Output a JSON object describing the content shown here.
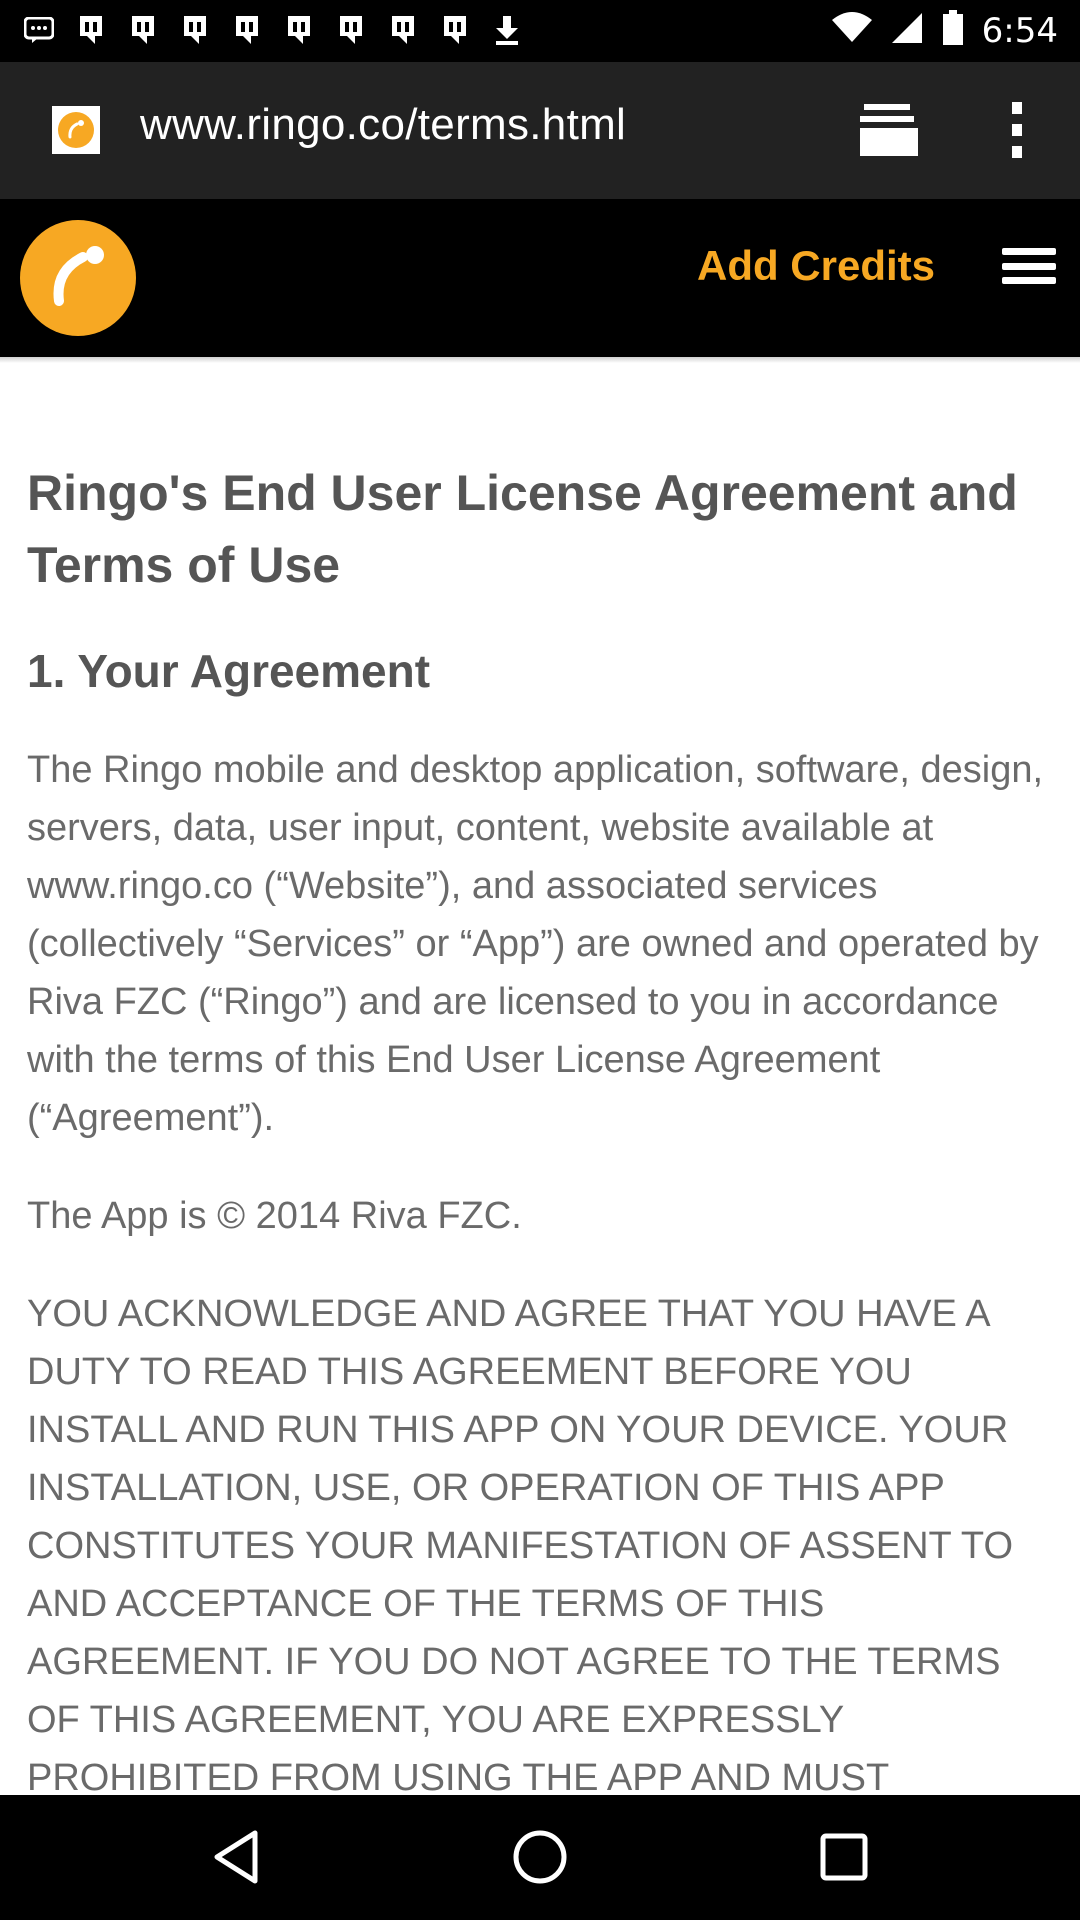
{
  "status_bar": {
    "time": "6:54",
    "notification_icons": [
      "message-icon",
      "bird-icon",
      "bird-icon",
      "bird-icon",
      "bird-icon",
      "bird-icon",
      "bird-icon",
      "bird-icon",
      "bird-icon",
      "download-icon"
    ],
    "battery_level": 0.9
  },
  "browser": {
    "url": "www.ringo.co/terms.html"
  },
  "header": {
    "add_credits_label": "Add Credits"
  },
  "content": {
    "title": "Ringo's End User License Agreement and Terms of Use",
    "section_heading": "1. Your Agreement",
    "paragraph_1": "The Ringo mobile and desktop application, software, design, servers, data, user input, content, website available at www.ringo.co (“Website”), and associated services (collectively “Services” or “App”) are owned and operated by Riva FZC (“Ringo”) and are licensed to you in accordance with the terms of this End User License Agreement (“Agreement”).",
    "paragraph_2": "The App is © 2014 Riva FZC.",
    "paragraph_3": "YOU ACKNOWLEDGE AND AGREE THAT YOU HAVE A DUTY TO READ THIS AGREEMENT BEFORE YOU INSTALL AND RUN THIS APP ON YOUR DEVICE. YOUR INSTALLATION, USE, OR OPERATION OF THIS APP CONSTITUTES YOUR MANIFESTATION OF ASSENT TO AND ACCEPTANCE OF THE TERMS OF THIS AGREEMENT. IF YOU DO NOT AGREE TO THE TERMS OF THIS AGREEMENT, YOU ARE EXPRESSLY PROHIBITED FROM USING THE APP AND MUST"
  },
  "colors": {
    "accent": "#f7a823",
    "toolbar": "#222222",
    "header": "#000000"
  }
}
